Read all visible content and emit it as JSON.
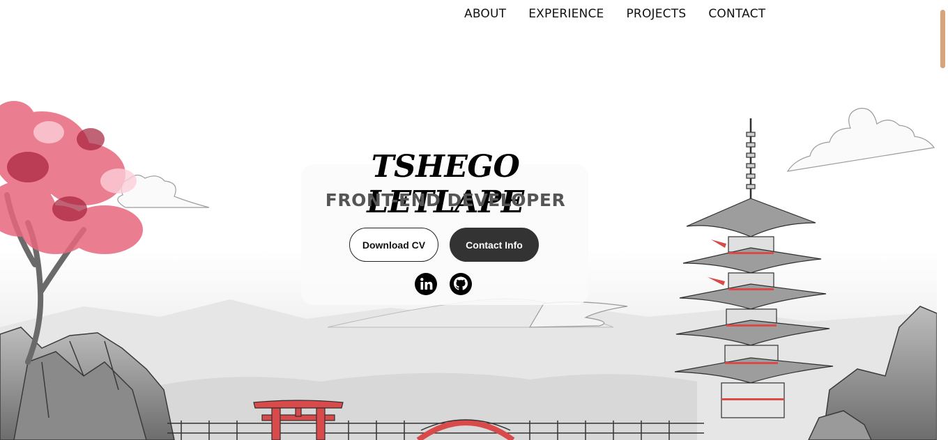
{
  "nav": {
    "items": [
      "ABOUT",
      "EXPERIENCE",
      "PROJECTS",
      "CONTACT"
    ]
  },
  "hero": {
    "name": "TSHEGO LETLAPE",
    "role": "FRONT-END DEVELOPER",
    "download_label": "Download CV",
    "contact_label": "Contact Info"
  },
  "social": [
    "linkedin-icon",
    "github-icon"
  ],
  "colors": {
    "blossom": "#e8677d",
    "torii": "#d94a4a",
    "ink": "#333333",
    "scroll_thumb": "#d9a37c"
  }
}
